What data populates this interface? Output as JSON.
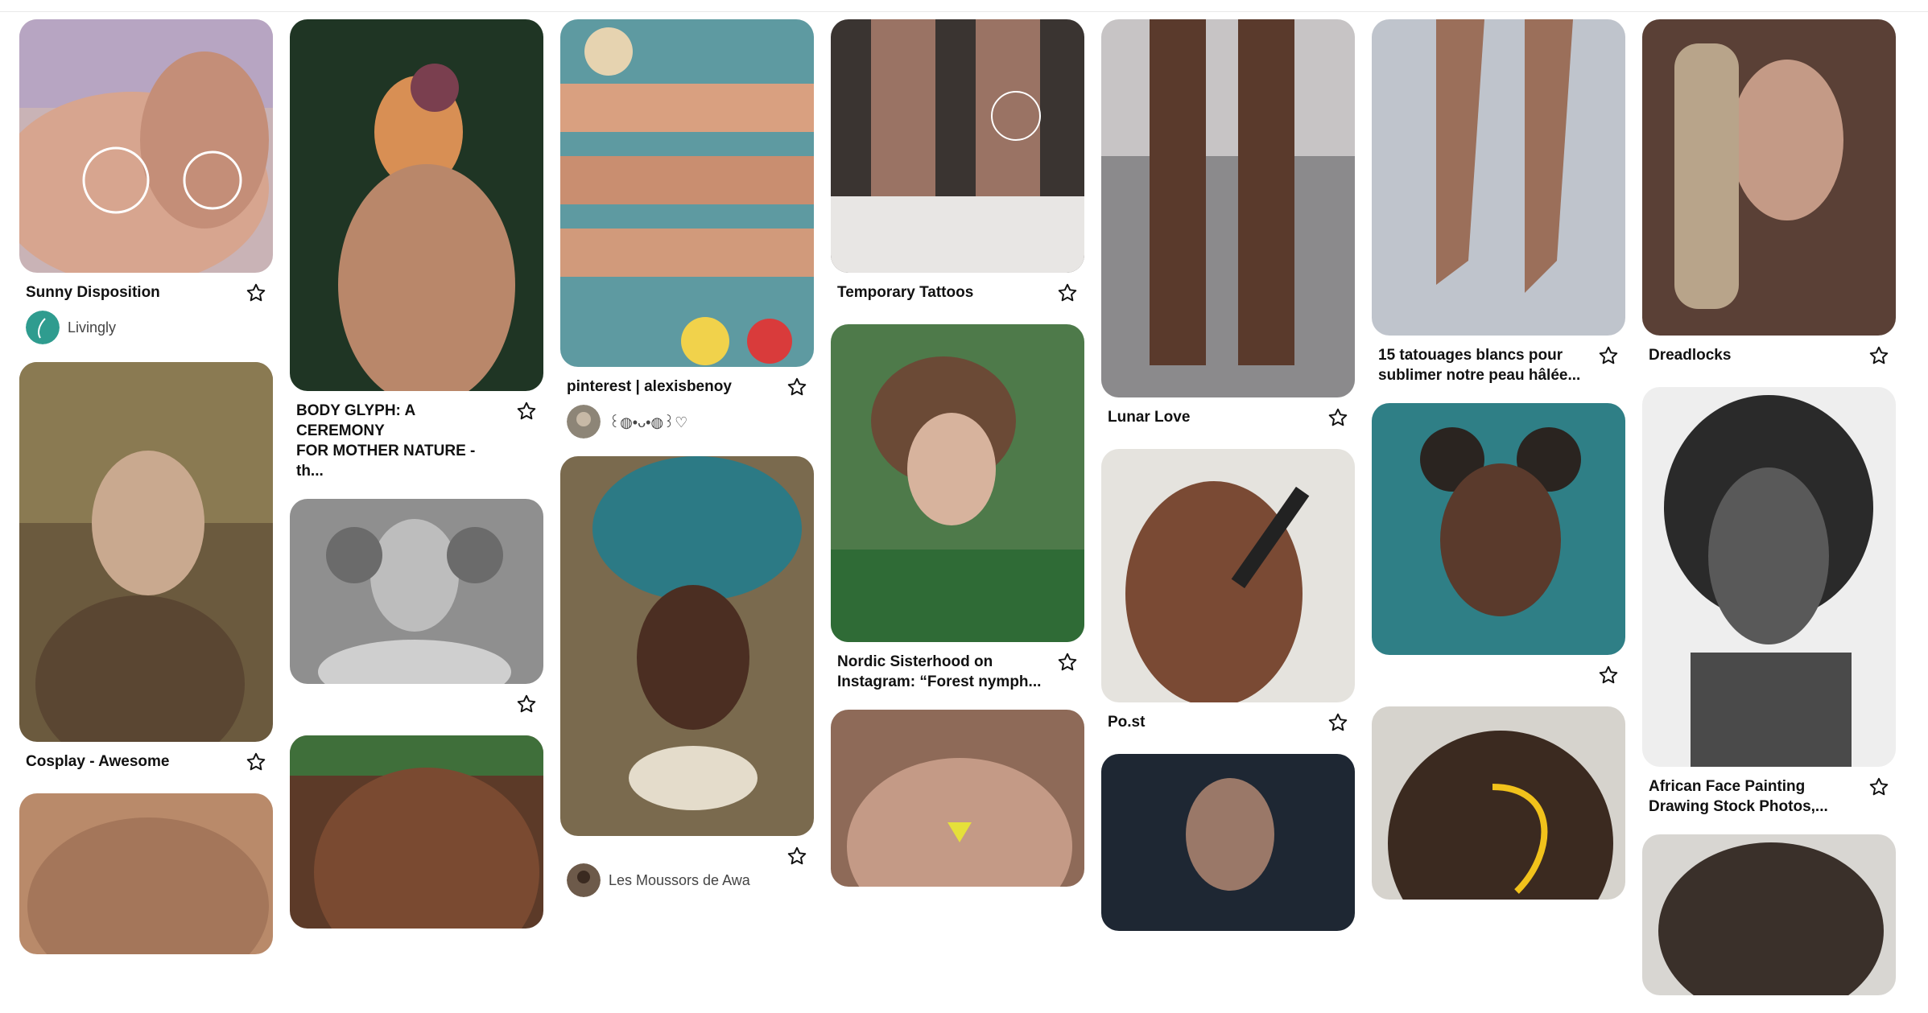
{
  "pins": {
    "c1p1": {
      "title": "Sunny Disposition",
      "author": "Livingly"
    },
    "c1p2": {
      "title": "Cosplay - Awesome"
    },
    "c2p1": {
      "title": "BODY GLYPH: A CEREMONY\nFOR MOTHER NATURE - th..."
    },
    "c3p1": {
      "title": "pinterest | alexisbenoy",
      "author": "꒰◍•ᴗ•◍꒱♡"
    },
    "c3p2": {
      "author": "Les Moussors de Awa"
    },
    "c4p1": {
      "title": "Temporary Tattoos"
    },
    "c4p2": {
      "title": "Nordic Sisterhood on\nInstagram: “Forest nymph..."
    },
    "c5p1": {
      "title": "Lunar Love"
    },
    "c5p2": {
      "title": "Po.st"
    },
    "c6p1": {
      "title": "15 tatouages blancs pour\nsublimer notre peau hâlée..."
    },
    "c7p1": {
      "title": "Dreadlocks"
    },
    "c7p2": {
      "title": "African Face Painting\nDrawing Stock Photos,..."
    }
  },
  "icons": {
    "save": "star-outline-icon",
    "avatar_livingly_color": "#2f9c8f"
  }
}
